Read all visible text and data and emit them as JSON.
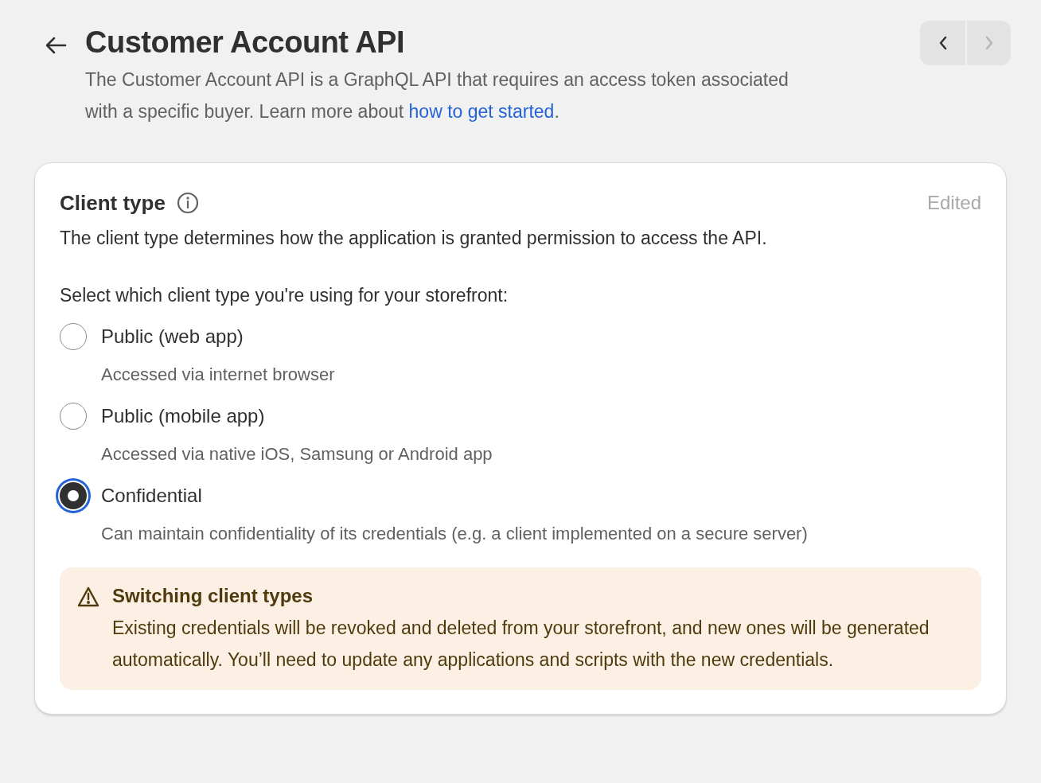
{
  "header": {
    "title": "Customer Account API",
    "description_before": "The Customer Account API is a GraphQL API that requires an access token associated with a specific buyer. Learn more about ",
    "link": "how to get started",
    "description_after": ".",
    "pager": [
      {
        "kind": "previous",
        "disabled": false
      },
      {
        "kind": "next",
        "disabled": true
      }
    ]
  },
  "card": {
    "title": "Client type",
    "status": "Edited",
    "description": "The client type determines how the application is granted permission to access the API.",
    "prompt": "Select which client type you're using for your storefront:",
    "options": [
      {
        "label": "Public (web app)",
        "hint": "Accessed via internet browser",
        "selected": false
      },
      {
        "label": "Public (mobile app)",
        "hint": "Accessed via native iOS, Samsung or Android app",
        "selected": false
      },
      {
        "label": "Confidential",
        "hint": "Can maintain confidentiality of its credentials (e.g. a client implemented on a secure server)",
        "selected": true
      }
    ],
    "warning": {
      "title": "Switching client types",
      "body": "Existing credentials will be revoked and deleted from your storefront, and new ones will be generated automatically. You’ll need to update any applications and scripts with the new credentials."
    }
  }
}
